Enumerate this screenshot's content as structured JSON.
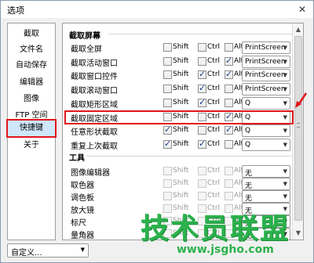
{
  "window": {
    "title": "选项"
  },
  "sidebar": {
    "items": [
      {
        "label": "截取"
      },
      {
        "label": "文件名"
      },
      {
        "label": "自动保存"
      },
      {
        "label": "编辑器"
      },
      {
        "label": "图像"
      },
      {
        "label": "FTP 空间"
      },
      {
        "label": "快捷键",
        "selected": true
      },
      {
        "label": "关于"
      }
    ]
  },
  "sections": {
    "capture": {
      "title": "截取屏幕",
      "rows": [
        {
          "label": "截取全屏",
          "shift": false,
          "ctrl": false,
          "alt": false,
          "key": "PrintScreen"
        },
        {
          "label": "截取活动窗口",
          "shift": false,
          "ctrl": false,
          "alt": true,
          "key": "PrintScreen"
        },
        {
          "label": "截取窗口控件",
          "shift": false,
          "ctrl": true,
          "alt": true,
          "key": "PrintScreen"
        },
        {
          "label": "截取滚动窗口",
          "shift": false,
          "ctrl": true,
          "alt": false,
          "key": "PrintScreen"
        },
        {
          "label": "截取矩形区域",
          "shift": false,
          "ctrl": true,
          "alt": false,
          "key": "Q"
        },
        {
          "label": "截取固定区域",
          "shift": false,
          "ctrl": false,
          "alt": true,
          "key": "Q",
          "highlighted": true
        },
        {
          "label": "任意形状截取",
          "shift": true,
          "ctrl": false,
          "alt": true,
          "key": "Q"
        },
        {
          "label": "重复上次截取",
          "shift": true,
          "ctrl": true,
          "alt": false,
          "key": "Q"
        }
      ]
    },
    "tools": {
      "title": "工具",
      "rows": [
        {
          "label": "图像编辑器",
          "key": "无"
        },
        {
          "label": "取色器",
          "key": "无"
        },
        {
          "label": "调色板",
          "key": "无"
        },
        {
          "label": "放大镜",
          "key": "无"
        },
        {
          "label": "标尺",
          "key": "无"
        },
        {
          "label": "量角器",
          "key": "无"
        }
      ]
    }
  },
  "modifiers": {
    "shift": "Shift",
    "ctrl": "Ctrl",
    "alt": "Alt"
  },
  "footer": {
    "preset": "自定义..."
  },
  "watermark": {
    "title": "技术员联盟",
    "url": "www.jsgho.com"
  },
  "colors": {
    "highlight": "#e0161b",
    "watermark": "#2bb24c",
    "selection": "#cfe6fb"
  }
}
